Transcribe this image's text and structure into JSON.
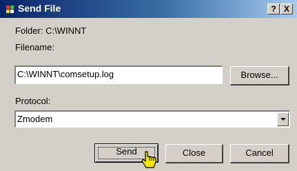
{
  "window": {
    "title": "Send File",
    "help_label": "?",
    "close_label": "X"
  },
  "folder": {
    "label": "Folder:  C:\\WINNT"
  },
  "filename": {
    "label": "Filename:",
    "value": "C:\\WINNT\\comsetup.log",
    "browse_label": "Browse..."
  },
  "protocol": {
    "label": "Protocol:",
    "selected": "Zmodem"
  },
  "buttons": {
    "send": "Send",
    "close": "Close",
    "cancel": "Cancel"
  },
  "colors": {
    "titlebar_start": "#0a246a",
    "titlebar_end": "#a6caf0",
    "dialog_face": "#d4d0c8"
  },
  "icons": {
    "app": "app-icon",
    "cursor": "hand-pointer-icon",
    "dropdown": "chevron-down-icon"
  }
}
